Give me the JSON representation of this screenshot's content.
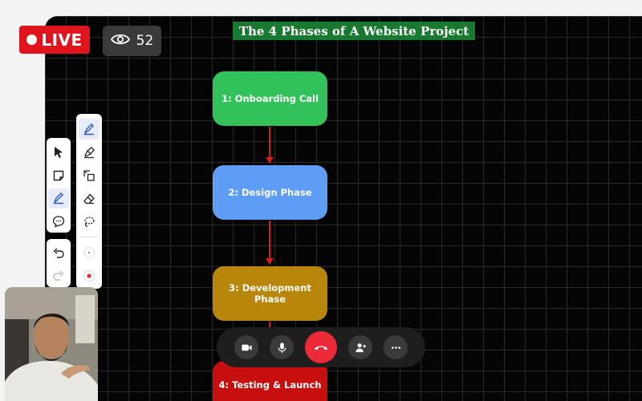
{
  "stream": {
    "live_label": "LIVE",
    "viewer_count": "52"
  },
  "board": {
    "title": "The 4 Phases of A Website Project",
    "phases": [
      {
        "label": "1: Onboarding Call",
        "color": "#33c15a"
      },
      {
        "label": "2: Design Phase",
        "color": "#5f9cf5"
      },
      {
        "label": "3: Development Phase",
        "color": "#b8860b"
      },
      {
        "label": "4: Testing & Launch",
        "color": "#c80f0f"
      }
    ],
    "arrow_color": "#d81c1c"
  },
  "toolbar": {
    "left_tools": [
      "select-icon",
      "sticky-note-icon",
      "pen-icon",
      "comment-icon"
    ],
    "right_tools": [
      "pen-icon",
      "highlighter-icon",
      "shape-icon",
      "eraser-icon",
      "lasso-icon"
    ]
  },
  "call_controls": [
    "camera-icon",
    "microphone-icon",
    "end-call-icon",
    "add-person-icon",
    "more-icon"
  ],
  "colors": {
    "live": "#e0141c",
    "end_call": "#ec2a3a"
  }
}
